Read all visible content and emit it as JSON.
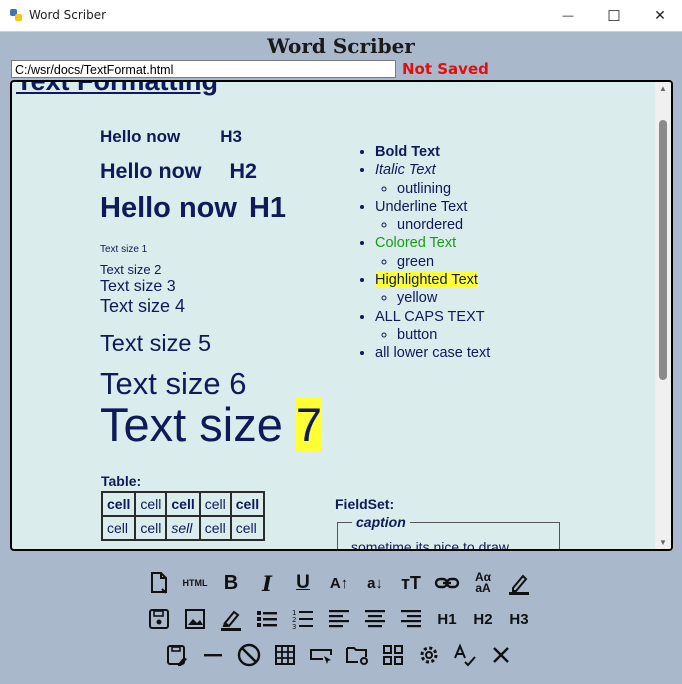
{
  "window": {
    "title": "Word Scriber",
    "minimize_glyph": "—",
    "maximize_glyph": "☐",
    "close_glyph": "✕"
  },
  "header": {
    "app_name": "Word Scriber"
  },
  "file": {
    "path": "C:/wsr/docs/TextFormat.html",
    "status": "Not Saved"
  },
  "document": {
    "heading": "Text Formatting",
    "h3": [
      "Hello now",
      "H3"
    ],
    "h2": [
      "Hello now",
      "H2"
    ],
    "h1": [
      "Hello now",
      "H1"
    ],
    "sizes": [
      "Text size 1",
      "Text size 2",
      "Text size 3",
      "Text size 4",
      "Text size 5",
      "Text size 6",
      "Text size ",
      "7"
    ],
    "list": [
      {
        "label": "Bold Text",
        "style": "bold"
      },
      {
        "label": "Italic Text",
        "style": "italic",
        "sub": "outlining"
      },
      {
        "label": "Underline Text",
        "style": "plain",
        "sub": "unordered"
      },
      {
        "label": "Colored Text",
        "style": "green",
        "sub": "green"
      },
      {
        "label": "Highlighted Text",
        "style": "highlight",
        "sub": "yellow"
      },
      {
        "label": "ALL CAPS TEXT",
        "style": "plain",
        "sub": "button"
      },
      {
        "label": "all lower case text",
        "style": "plain"
      }
    ],
    "table_label": "Table:",
    "table": [
      [
        "cell",
        "cell",
        "cell",
        "cell",
        "cell"
      ],
      [
        "cell",
        "cell",
        "sell",
        "cell",
        "cell"
      ]
    ],
    "fieldset_label": "FieldSet:",
    "fieldset_caption": "caption",
    "fieldset_text": "sometime its nice to draw"
  },
  "colors": {
    "text": "#0e1a5a",
    "green": "#1a9a1a",
    "highlight": "#ffff33",
    "status": "#e01010",
    "background": "#a9b8cb",
    "editor_bg": "#daeceb"
  },
  "toolbar": {
    "row1": [
      "new-doc-icon",
      "html-icon",
      "bold-icon",
      "italic-icon",
      "underline-icon",
      "font-increase-icon",
      "font-decrease-icon",
      "text-size-icon",
      "link-icon",
      "caps-case-icon",
      "font-color-icon"
    ],
    "row2": [
      "save-icon",
      "image-icon",
      "highlighter-icon",
      "bulleted-list-icon",
      "numbered-list-icon",
      "align-left-icon",
      "align-center-icon",
      "align-right-icon",
      "h1-icon",
      "h2-icon",
      "h3-icon"
    ],
    "row3": [
      "save-as-icon",
      "horizontal-rule-icon",
      "clear-format-icon",
      "table-icon",
      "input-field-icon",
      "open-folder-icon",
      "widgets-icon",
      "settings-icon",
      "spellcheck-icon",
      "close-icon"
    ],
    "labels": {
      "html": "HTML",
      "h1": "H1",
      "h2": "H2",
      "h3": "H3",
      "bold": "B",
      "italic": "I",
      "underline": "U"
    }
  }
}
